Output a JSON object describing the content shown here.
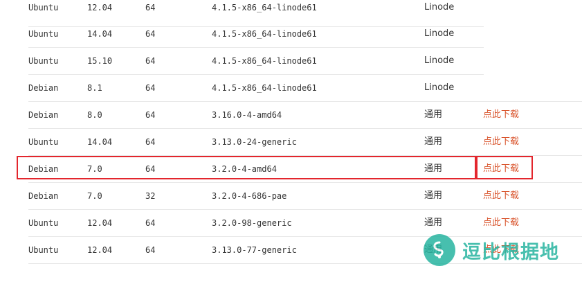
{
  "rows": [
    {
      "os": "Ubuntu",
      "version": "12.04",
      "bits": "64",
      "kernel": "4.1.5-x86_64-linode61",
      "source": "Linode",
      "download": ""
    },
    {
      "os": "Ubuntu",
      "version": "14.04",
      "bits": "64",
      "kernel": "4.1.5-x86_64-linode61",
      "source": "Linode",
      "download": ""
    },
    {
      "os": "Ubuntu",
      "version": "15.10",
      "bits": "64",
      "kernel": "4.1.5-x86_64-linode61",
      "source": "Linode",
      "download": ""
    },
    {
      "os": "Debian",
      "version": "8.1",
      "bits": "64",
      "kernel": "4.1.5-x86_64-linode61",
      "source": "Linode",
      "download": ""
    },
    {
      "os": "Debian",
      "version": "8.0",
      "bits": "64",
      "kernel": "3.16.0-4-amd64",
      "source": "通用",
      "download": "点此下载"
    },
    {
      "os": "Ubuntu",
      "version": "14.04",
      "bits": "64",
      "kernel": "3.13.0-24-generic",
      "source": "通用",
      "download": "点此下载"
    },
    {
      "os": "Debian",
      "version": "7.0",
      "bits": "64",
      "kernel": "3.2.0-4-amd64",
      "source": "通用",
      "download": "点此下载"
    },
    {
      "os": "Debian",
      "version": "7.0",
      "bits": "32",
      "kernel": "3.2.0-4-686-pae",
      "source": "通用",
      "download": "点此下载"
    },
    {
      "os": "Ubuntu",
      "version": "12.04",
      "bits": "64",
      "kernel": "3.2.0-98-generic",
      "source": "通用",
      "download": "点此下载"
    },
    {
      "os": "Ubuntu",
      "version": "12.04",
      "bits": "64",
      "kernel": "3.13.0-77-generic",
      "source": "通用",
      "download": "点此下载"
    }
  ],
  "watermark": {
    "text": "逗比根据地",
    "color": "#27b4a0"
  },
  "colors": {
    "download_link": "#d9542c",
    "highlight_border": "#e3262d",
    "divider": "#e8e8e8"
  }
}
